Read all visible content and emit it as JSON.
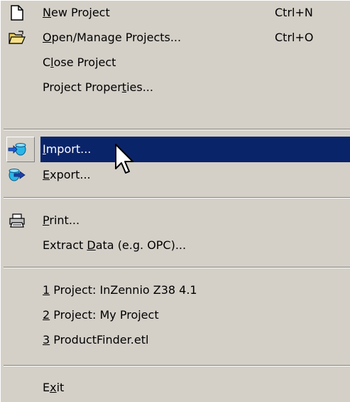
{
  "menu": {
    "items": [
      {
        "label_pre": "",
        "label_ul": "N",
        "label_post": "ew Project",
        "shortcut": "Ctrl+N",
        "icon": "new-document-icon"
      },
      {
        "label_pre": "",
        "label_ul": "O",
        "label_post": "pen/Manage Projects...",
        "shortcut": "Ctrl+O",
        "icon": "open-folder-icon"
      },
      {
        "label_pre": "C",
        "label_ul": "l",
        "label_post": "ose Project",
        "shortcut": "",
        "icon": ""
      },
      {
        "label_pre": "Project Proper",
        "label_ul": "t",
        "label_post": "ies...",
        "shortcut": "",
        "icon": ""
      },
      {
        "label_pre": "",
        "label_ul": "I",
        "label_post": "mport...",
        "shortcut": "",
        "icon": "import-icon"
      },
      {
        "label_pre": "",
        "label_ul": "E",
        "label_post": "xport...",
        "shortcut": "",
        "icon": "export-icon"
      },
      {
        "label_pre": "",
        "label_ul": "P",
        "label_post": "rint...",
        "shortcut": "",
        "icon": "printer-icon"
      },
      {
        "label_pre": "Extract ",
        "label_ul": "D",
        "label_post": "ata (e.g. OPC)...",
        "shortcut": "",
        "icon": ""
      },
      {
        "label_pre": "",
        "label_ul": "1",
        "label_post": " Project: InZennio Z38 4.1",
        "shortcut": "",
        "icon": ""
      },
      {
        "label_pre": "",
        "label_ul": "2",
        "label_post": " Project: My Project",
        "shortcut": "",
        "icon": ""
      },
      {
        "label_pre": "",
        "label_ul": "3",
        "label_post": " ProductFinder.etl",
        "shortcut": "",
        "icon": ""
      },
      {
        "label_pre": "E",
        "label_ul": "x",
        "label_post": "it",
        "shortcut": "",
        "icon": ""
      }
    ],
    "highlighted_index": 4,
    "colors": {
      "menu_bg": "#d4d0c8",
      "highlight_bg": "#0a246a",
      "highlight_text": "#ffffff"
    }
  }
}
